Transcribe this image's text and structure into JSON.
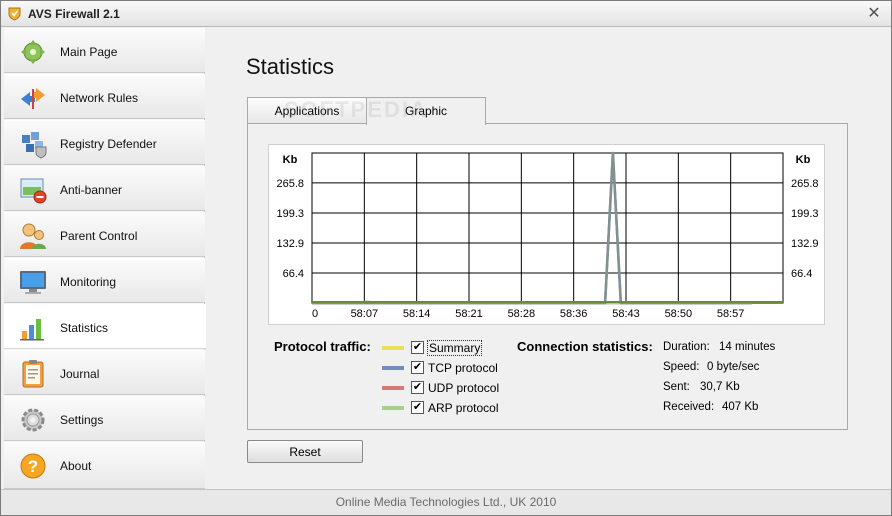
{
  "window": {
    "title": "AVS Firewall 2.1",
    "close_symbol": "✕"
  },
  "sidebar": {
    "items": [
      {
        "label": "Main Page",
        "icon": "main-page-icon",
        "active": false
      },
      {
        "label": "Network Rules",
        "icon": "network-rules-icon",
        "active": false
      },
      {
        "label": "Registry Defender",
        "icon": "registry-defender-icon",
        "active": false
      },
      {
        "label": "Anti-banner",
        "icon": "anti-banner-icon",
        "active": false
      },
      {
        "label": "Parent Control",
        "icon": "parent-control-icon",
        "active": false
      },
      {
        "label": "Monitoring",
        "icon": "monitoring-icon",
        "active": false
      },
      {
        "label": "Statistics",
        "icon": "statistics-icon",
        "active": true
      },
      {
        "label": "Journal",
        "icon": "journal-icon",
        "active": false
      },
      {
        "label": "Settings",
        "icon": "settings-icon",
        "active": false
      },
      {
        "label": "About",
        "icon": "about-icon",
        "active": false
      }
    ]
  },
  "main": {
    "title": "Statistics",
    "tabs": [
      {
        "label": "Applications",
        "active": false
      },
      {
        "label": "Graphic",
        "active": true
      }
    ],
    "watermark": "SOFTPEDIA"
  },
  "chart_data": {
    "type": "line",
    "ylabel_left": "Kb",
    "ylabel_right": "Kb",
    "y_ticks": [
      "66.4",
      "132.9",
      "199.3",
      "265.8"
    ],
    "x_ticks": [
      "0",
      "58:07",
      "58:14",
      "58:21",
      "58:28",
      "58:36",
      "58:43",
      "58:50",
      "58:57"
    ],
    "ylim": [
      0,
      332
    ],
    "grid": true,
    "series": [
      {
        "name": "Summary",
        "color": "#e8e05a",
        "points": [
          [
            0,
            0
          ],
          [
            0.9,
            0
          ],
          [
            1.05,
            3
          ],
          [
            1.2,
            0
          ],
          [
            5.6,
            0
          ],
          [
            5.75,
            332
          ],
          [
            5.9,
            0
          ],
          [
            8.4,
            0
          ]
        ]
      },
      {
        "name": "TCP protocol",
        "color": "#6f8fb8",
        "points": [
          [
            0,
            0
          ],
          [
            5.6,
            0
          ],
          [
            5.75,
            332
          ],
          [
            5.9,
            0
          ],
          [
            8.4,
            0
          ]
        ]
      },
      {
        "name": "UDP protocol",
        "color": "#d47a7a",
        "points": [
          [
            0,
            0
          ],
          [
            8.4,
            0
          ]
        ]
      },
      {
        "name": "ARP protocol",
        "color": "#a6cf8c",
        "points": [
          [
            0,
            0
          ],
          [
            0.9,
            0
          ],
          [
            1.05,
            3
          ],
          [
            1.2,
            0
          ],
          [
            8.4,
            0
          ]
        ]
      }
    ]
  },
  "legend": {
    "title": "Protocol traffic:",
    "items": [
      {
        "label": "Summary",
        "color": "#e8e05a",
        "checked": true,
        "check_symbol": "✔"
      },
      {
        "label": "TCP protocol",
        "color": "#6f8fb8",
        "checked": true,
        "check_symbol": "✔"
      },
      {
        "label": "UDP protocol",
        "color": "#d47a7a",
        "checked": true,
        "check_symbol": "✔"
      },
      {
        "label": "ARP protocol",
        "color": "#a6cf8c",
        "checked": true,
        "check_symbol": "✔"
      }
    ]
  },
  "connection": {
    "title": "Connection statistics:",
    "rows": [
      {
        "label": "Duration:",
        "value": "14 minutes"
      },
      {
        "label": "Speed:",
        "value": "0 byte/sec"
      },
      {
        "label": "Sent:",
        "value": "30,7 Kb"
      },
      {
        "label": "Received:",
        "value": "407 Kb"
      }
    ]
  },
  "reset_label": "Reset",
  "status_text": "Online Media Technologies Ltd., UK 2010"
}
